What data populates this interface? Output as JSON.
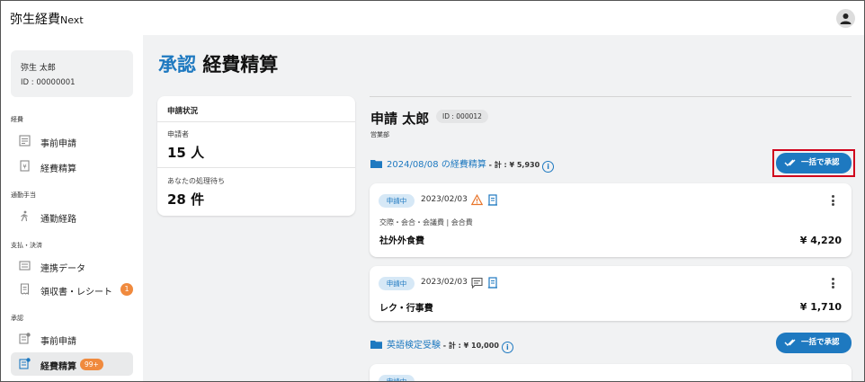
{
  "app": {
    "title": "弥生経費",
    "title_suffix": "Next"
  },
  "user": {
    "name": "弥生 太郎",
    "id": "ID : 00000001"
  },
  "sidebar": {
    "sections": [
      {
        "label": "経費",
        "items": [
          {
            "label": "事前申請",
            "icon": "document-icon"
          },
          {
            "label": "経費精算",
            "icon": "receipt-icon"
          }
        ]
      },
      {
        "label": "通勤手当",
        "items": [
          {
            "label": "通勤経路",
            "icon": "walking-icon"
          }
        ]
      },
      {
        "label": "支払・決済",
        "items": [
          {
            "label": "連携データ",
            "icon": "link-data-icon"
          },
          {
            "label": "領収書・レシート",
            "icon": "receipt-doc-icon",
            "badge": "1"
          }
        ]
      },
      {
        "label": "承認",
        "items": [
          {
            "label": "事前申請",
            "icon": "approval-doc-icon"
          },
          {
            "label": "経費精算",
            "icon": "approval-expense-icon",
            "badge": "99+",
            "active": true
          }
        ]
      }
    ]
  },
  "page": {
    "title_accent": "承認",
    "title_rest": "経費精算"
  },
  "status_card": {
    "heading": "申請状況",
    "applicants_label": "申請者",
    "applicants_value": "15 人",
    "pending_label": "あなたの処理待ち",
    "pending_value": "28 件"
  },
  "applicant": {
    "name": "申請 太郎",
    "id": "ID : 000012",
    "department": "営業部"
  },
  "groups": [
    {
      "title": "2024/08/08 の経費精算",
      "total": " - 計 : ¥ 5,930",
      "button": "一括で承認"
    },
    {
      "title": "英語検定受験",
      "total": " - 計 : ¥ 10,000",
      "button": "一括で承認"
    }
  ],
  "expenses": [
    {
      "status": "申請中",
      "date": "2023/02/03",
      "category": "交際・会合・会議費 | 会合費",
      "name": "社外外食費",
      "amount": "¥ 4,220",
      "icons": [
        "warning-icon",
        "receipt-icon"
      ]
    },
    {
      "status": "申請中",
      "date": "2023/02/03",
      "category": "",
      "name": "レク・行事費",
      "amount": "¥ 1,710",
      "icons": [
        "comment-icon",
        "receipt-icon"
      ]
    },
    {
      "status": "申請中",
      "date": "",
      "category": "",
      "name": "",
      "amount": ""
    }
  ],
  "colors": {
    "accent": "#1e79c0",
    "badge": "#f08a3e",
    "highlight": "#d0021b",
    "warning": "#e8742a"
  }
}
